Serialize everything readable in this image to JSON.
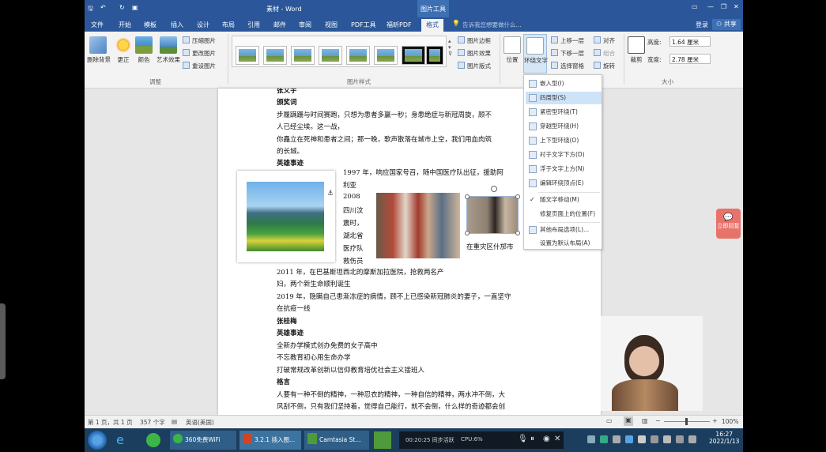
{
  "window": {
    "title": "素材 - Word",
    "context_tab": "图片工具",
    "login": "登录",
    "share": "共享"
  },
  "ribbon_tabs": [
    "文件",
    "开始",
    "模板",
    "插入",
    "设计",
    "布局",
    "引用",
    "邮件",
    "审阅",
    "视图",
    "PDF工具",
    "福昕PDF",
    "格式"
  ],
  "search_placeholder": "告诉我您想要做什么...",
  "ribbon": {
    "adjust": {
      "remove_bg": "删除背景",
      "corrections": "更正",
      "color": "颜色",
      "artistic": "艺术效果",
      "compress": "压缩图片",
      "change": "更改图片",
      "reset": "重设图片",
      "group_label": "调整"
    },
    "styles": {
      "border": "图片边框",
      "effects": "图片效果",
      "layout": "图片版式",
      "group_label": "图片样式"
    },
    "arrange": {
      "position": "位置",
      "wrap_text": "环绕文字",
      "bring_forward": "上移一层",
      "send_backward": "下移一层",
      "selection_pane": "选择窗格",
      "align": "对齐",
      "group": "组合",
      "rotate": "旋转"
    },
    "size": {
      "crop": "裁剪",
      "height_label": "高度:",
      "height": "1.64 厘米",
      "width_label": "宽度:",
      "width": "2.78 厘米",
      "group_label": "大小"
    }
  },
  "wrap_menu": [
    "嵌入型(I)",
    "四周型(S)",
    "紧密型环绕(T)",
    "穿越型环绕(H)",
    "上下型环绕(O)",
    "衬于文字下方(D)",
    "浮于文字上方(N)",
    "编辑环绕顶点(E)",
    "随文字移动(M)",
    "修复页面上的位置(F)",
    "其他布局选项(L)...",
    "设置为默认布局(A)"
  ],
  "document": {
    "lines_top": [
      {
        "text": "张文宇",
        "bold": true
      },
      {
        "text": "颁奖词",
        "bold": true
      },
      {
        "text": "步履蹒跚与时间赛跑，只想为患者多赢一秒；身患绝症与新冠周旋，顾不",
        "bold": false
      },
      {
        "text": "人已经尘埃。这一战，",
        "bold": false
      },
      {
        "text": "你矗立在死神和患者之间；那一晚，歌声散落在城市上空，我们用血肉筑",
        "bold": false
      },
      {
        "text": "的长城。",
        "bold": false
      },
      {
        "text": "英雄事迹",
        "bold": true
      }
    ],
    "side_lines": [
      "1997 年，响应国家号召，随中国医疗队出征，援助阿",
      "利亚",
      "2008",
      "四川汶",
      "震时，",
      "湖北省",
      "医疗队",
      "救伤员"
    ],
    "caption": "在重灾区什邡市",
    "lines_bottom": [
      {
        "text": "2011 年，在巴基斯坦西北的摩斯加拉医院，抢救两名产",
        "bold": false
      },
      {
        "text": "妇，两个新生命顺利诞生",
        "bold": false
      },
      {
        "text": "2019 年，隐瞒自己患渐冻症的病情，顾不上已感染新冠肺炎的妻子，一直坚守",
        "bold": false
      },
      {
        "text": "在抗疫一线",
        "bold": false
      },
      {
        "text": "张桂梅",
        "bold": true
      },
      {
        "text": "英雄事迹",
        "bold": true
      },
      {
        "text": "全新办学模式创办免费的女子高中",
        "bold": false
      },
      {
        "text": "不忘教育初心用生命办学",
        "bold": false
      },
      {
        "text": "打破常规改革创新以信仰教育培优社会主义接班人",
        "bold": false
      },
      {
        "text": "格言",
        "bold": true
      },
      {
        "text": "人要有一种不倒的精神，一种忍衣的精神，一种自信的精神，两水冲不倒，大",
        "bold": false
      },
      {
        "text": "风刮不倒，只有我们坚持着，觉得自己能行，就不会倒，什么样的奇迹都会创",
        "bold": false
      }
    ]
  },
  "float_button": "立即回复",
  "status": {
    "page": "第 1 页，共 1 页",
    "words": "357 个字",
    "lang": "英语(美国)",
    "zoom": "100%"
  },
  "taskbar": {
    "items": [
      "360免费WiFi",
      "3.2.1 插入图...",
      "Camtasia St..."
    ],
    "recording": "00:20:25 同步活跃",
    "cpu": "CPU:6%",
    "time": "16:27",
    "date": "2022/1/13"
  },
  "colors": {
    "word_blue": "#2b579a",
    "taskbar": "#1c3e5e",
    "float_button": "#e8736b"
  }
}
